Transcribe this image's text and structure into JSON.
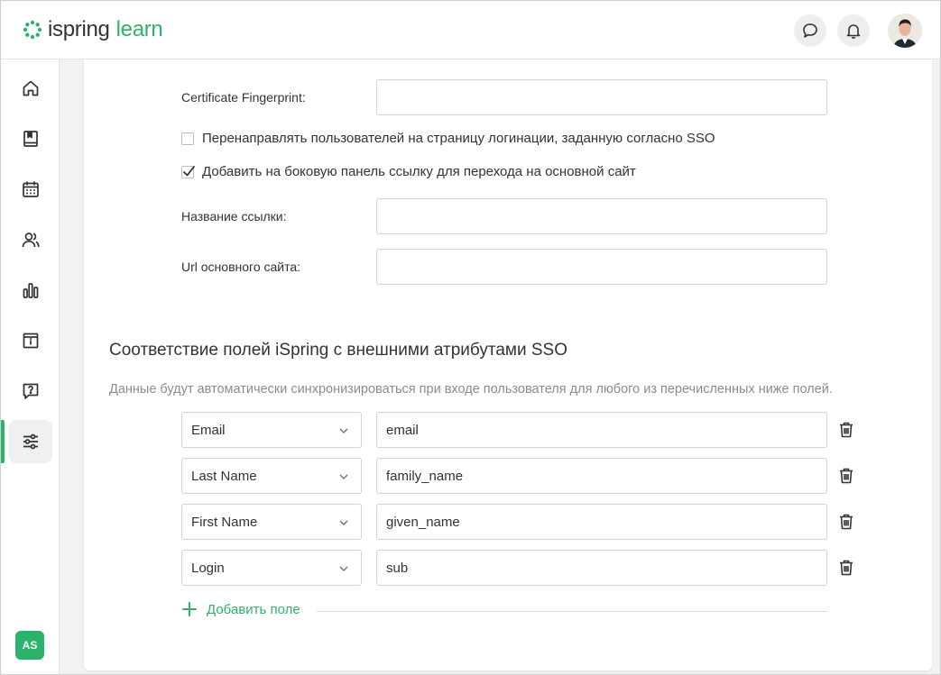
{
  "app": {
    "logo_word1": "ispring",
    "logo_word2": "learn",
    "brand_color": "#2cb36b"
  },
  "header": {
    "icons": [
      "chat-icon",
      "bell-icon",
      "user-avatar"
    ]
  },
  "sidebar": {
    "items": [
      {
        "name": "home",
        "icon": "home-icon"
      },
      {
        "name": "courses",
        "icon": "book-icon"
      },
      {
        "name": "calendar",
        "icon": "calendar-icon"
      },
      {
        "name": "users",
        "icon": "users-icon"
      },
      {
        "name": "reports",
        "icon": "bar-chart-icon"
      },
      {
        "name": "info",
        "icon": "info-board-icon"
      },
      {
        "name": "help",
        "icon": "question-chat-icon"
      },
      {
        "name": "settings",
        "icon": "sliders-icon",
        "active": true
      }
    ],
    "user_initials": "AS"
  },
  "form": {
    "cert_fingerprint_label": "Certificate Fingerprint:",
    "cert_fingerprint_value": "",
    "redirect_checkbox_label": "Перенаправлять пользователей на страницу логинации, заданную согласно SSO",
    "redirect_checked": false,
    "sidebar_link_checkbox_label": "Добавить на боковую панель ссылку для перехода на основной сайт",
    "sidebar_link_checked": true,
    "link_name_label": "Название ссылки:",
    "link_name_value": "",
    "site_url_label": "Url основного сайта:",
    "site_url_value": ""
  },
  "mapping": {
    "title": "Соответствие полей iSpring с внешними атрибутами SSO",
    "description": "Данные будут автоматически синхронизироваться при входе пользователя для любого из перечисленных ниже полей.",
    "rows": [
      {
        "field": "Email",
        "attribute": "email"
      },
      {
        "field": "Last Name",
        "attribute": "family_name"
      },
      {
        "field": "First Name",
        "attribute": "given_name"
      },
      {
        "field": "Login",
        "attribute": "sub"
      }
    ],
    "add_field_label": "Добавить поле"
  }
}
